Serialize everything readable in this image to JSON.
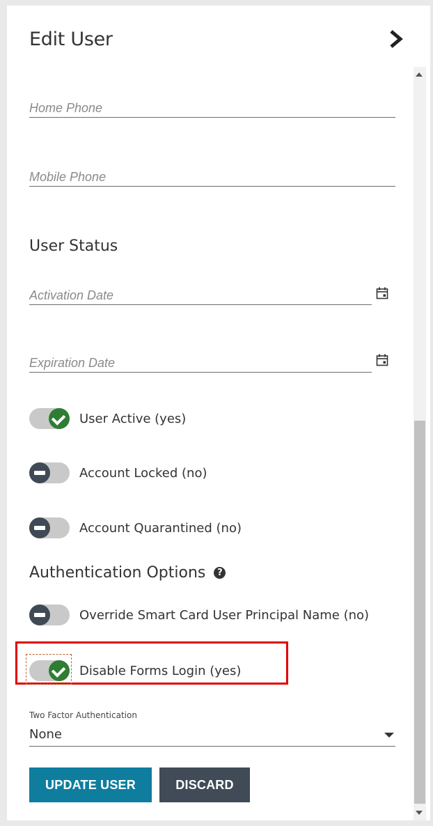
{
  "header": {
    "title": "Edit User",
    "collapse_icon": "chevron-right"
  },
  "fields": {
    "home_phone": {
      "placeholder": "Home Phone",
      "value": ""
    },
    "mobile_phone": {
      "placeholder": "Mobile Phone",
      "value": ""
    }
  },
  "user_status": {
    "heading": "User Status",
    "activation_date": {
      "placeholder": "Activation Date",
      "icon": "calendar-icon"
    },
    "expiration_date": {
      "placeholder": "Expiration Date",
      "icon": "calendar-icon"
    },
    "toggles": [
      {
        "label": "User Active (yes)",
        "state": "on"
      },
      {
        "label": "Account Locked (no)",
        "state": "off"
      },
      {
        "label": "Account Quarantined (no)",
        "state": "off"
      }
    ]
  },
  "authentication": {
    "heading": "Authentication Options",
    "help_icon": "?",
    "toggles": [
      {
        "label": "Override Smart Card User Principal Name (no)",
        "state": "off"
      },
      {
        "label": "Disable Forms Login (yes)",
        "state": "on"
      }
    ],
    "two_factor": {
      "label": "Two Factor Authentication",
      "value": "None"
    }
  },
  "actions": {
    "update_label": "UPDATE USER",
    "discard_label": "DISCARD"
  },
  "colors": {
    "accent": "#0f7e9e",
    "toggle_on": "#2e7d32",
    "toggle_off": "#3f4a56",
    "highlight": "#e00000"
  }
}
